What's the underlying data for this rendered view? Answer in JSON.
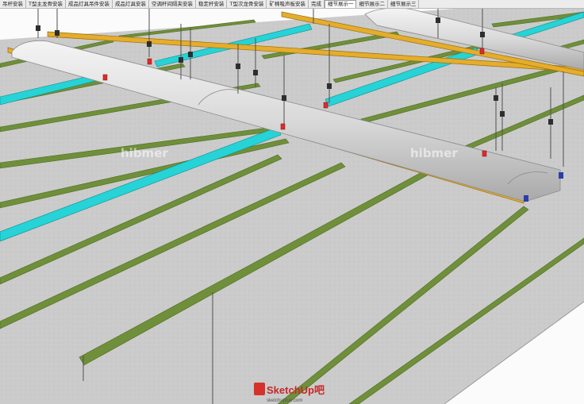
{
  "tabs": [
    {
      "label": "吊杆安装",
      "active": false
    },
    {
      "label": "T型主龙骨安装",
      "active": false
    },
    {
      "label": "成品灯具吊件安装",
      "active": false
    },
    {
      "label": "成品灯具安装",
      "active": false
    },
    {
      "label": "空调杆间隔夹安装",
      "active": false
    },
    {
      "label": "稳定杆安装",
      "active": false
    },
    {
      "label": "T型次龙骨安装",
      "active": false
    },
    {
      "label": "矿棉吸声板安装",
      "active": false
    },
    {
      "label": "完成",
      "active": false
    },
    {
      "label": "细节展示一",
      "active": true
    },
    {
      "label": "细节展示二",
      "active": false
    },
    {
      "label": "细节展示三",
      "active": false
    }
  ],
  "watermarks": [
    "hibmer",
    "hibmer"
  ],
  "logo": {
    "text": "SketchUp吧",
    "subtext": "sketchupbar.com"
  },
  "colors": {
    "panel": "#c9c9c9",
    "main_runner": "#e4ad2c",
    "cross_tee": "#6f8f3a",
    "light_strip": "#26d3d6",
    "duct": "#dcdcdc",
    "hanger_rod": "#505050",
    "clip": "#e02a2a"
  }
}
